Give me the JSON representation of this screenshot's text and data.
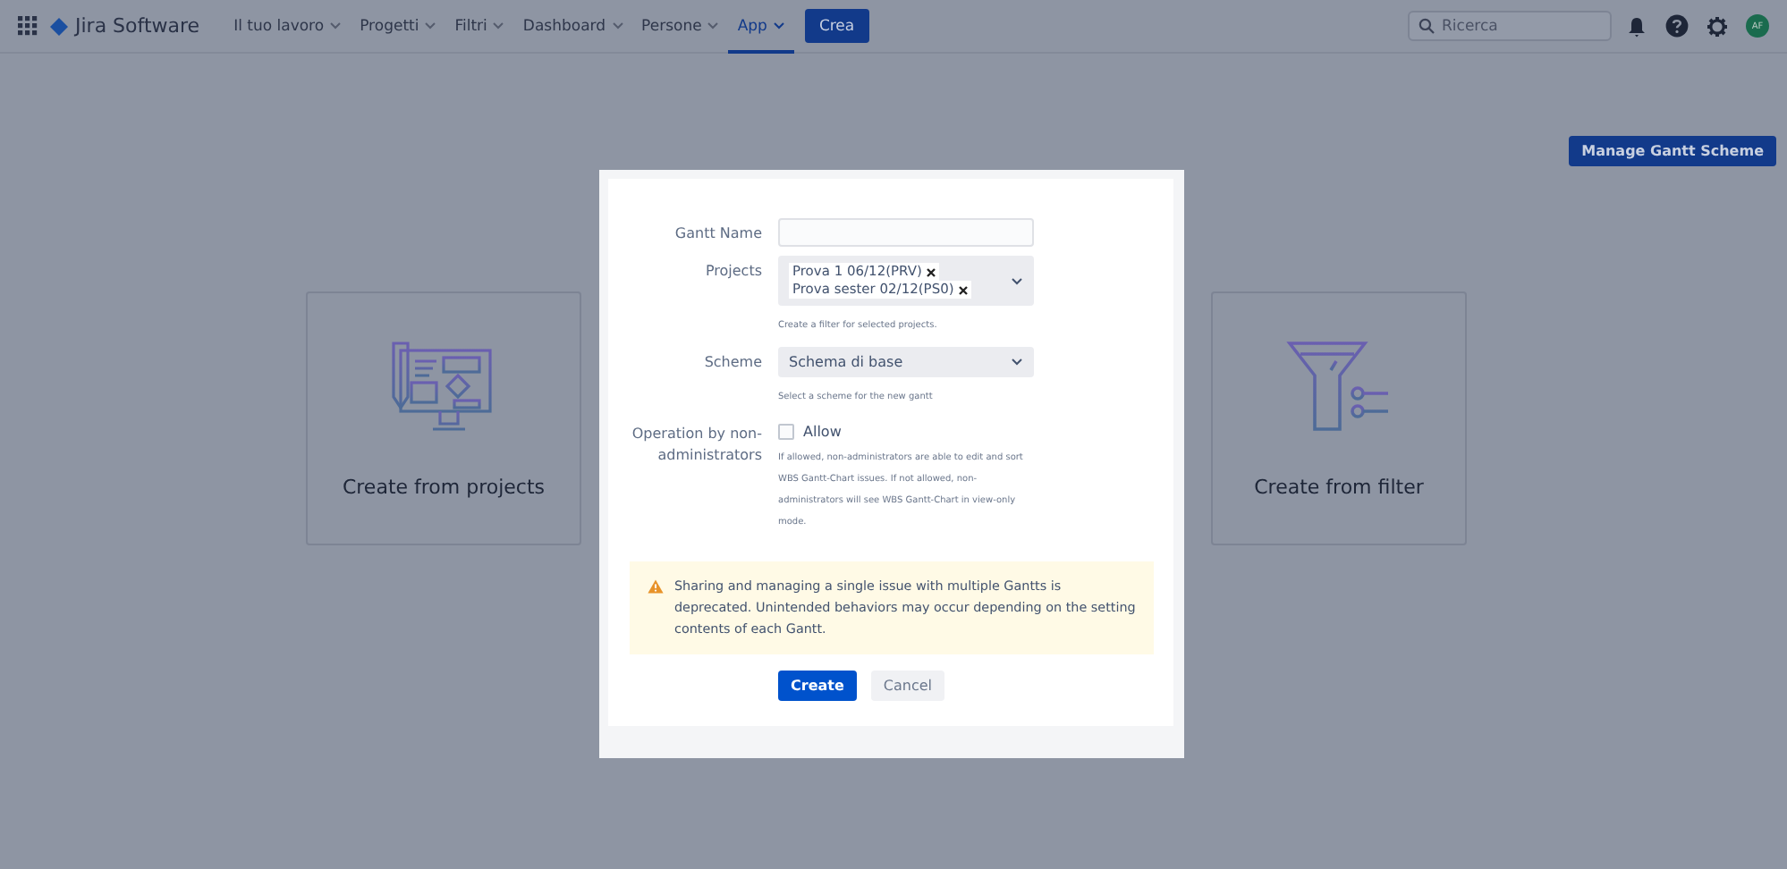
{
  "header": {
    "logo": "Jira Software",
    "nav": [
      {
        "label": "Il tuo lavoro",
        "selected": false
      },
      {
        "label": "Progetti",
        "selected": false
      },
      {
        "label": "Filtri",
        "selected": false
      },
      {
        "label": "Dashboard",
        "selected": false
      },
      {
        "label": "Persone",
        "selected": false
      },
      {
        "label": "App",
        "selected": true
      }
    ],
    "create_button": "Crea",
    "search": {
      "placeholder": "Ricerca"
    },
    "avatar": "AF"
  },
  "manage_button": "Manage Gantt Scheme",
  "cards": [
    {
      "kind": "projects",
      "label": "Create from projects"
    },
    {
      "kind": "filter",
      "label": "Create from filter"
    }
  ],
  "dialog": {
    "gantt_name": {
      "label": "Gantt Name"
    },
    "projects": {
      "label": "Projects",
      "tags": [
        "Prova 1 06/12(PRV)",
        "Prova sester 02/12(PS0)"
      ],
      "help": "Create a filter for selected projects."
    },
    "scheme": {
      "label": "Scheme",
      "value": "Schema di base",
      "help": "Select a scheme for the new gantt"
    },
    "operation": {
      "label": "Operation by non-administrators",
      "checkbox_label": "Allow",
      "checked": false,
      "help": "If allowed, non-administrators are able to edit and sort WBS Gantt-Chart issues. If not allowed, non-administrators will see WBS Gantt-Chart in view-only mode."
    },
    "warning": "Sharing and managing a single issue with multiple Gantts is deprecated. Unintended behaviors may occur depending on the setting contents of each Gantt.",
    "buttons": [
      "Create",
      "Cancel"
    ]
  }
}
